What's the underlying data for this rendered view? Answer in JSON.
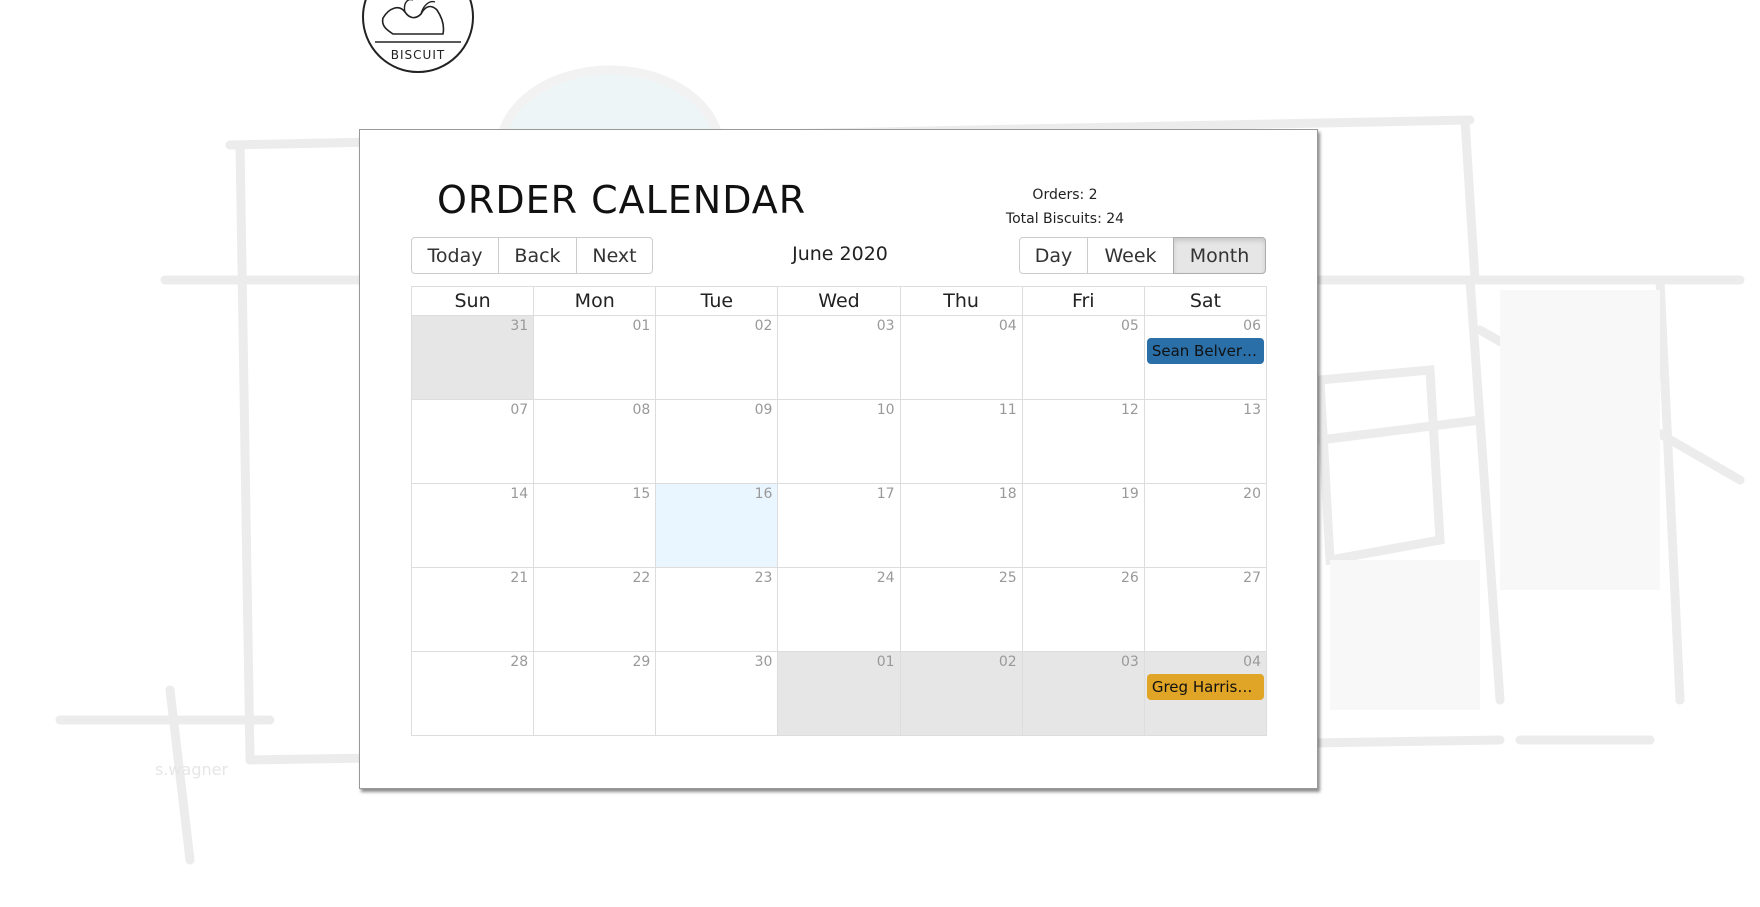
{
  "logo": {
    "text": "BISCUIT",
    "icon": "rooster-icon"
  },
  "calendar": {
    "title": "ORDER CALENDAR",
    "orders_label": "Orders: 2",
    "biscuits_label": "Total Biscuits: 24",
    "month_label": "June 2020",
    "nav": {
      "today": "Today",
      "back": "Back",
      "next": "Next"
    },
    "views": {
      "day": "Day",
      "week": "Week",
      "month": "Month",
      "active": "Month"
    },
    "weekdays": [
      "Sun",
      "Mon",
      "Tue",
      "Wed",
      "Thu",
      "Fri",
      "Sat"
    ],
    "weeks": [
      [
        "31",
        "01",
        "02",
        "03",
        "04",
        "05",
        "06"
      ],
      [
        "07",
        "08",
        "09",
        "10",
        "11",
        "12",
        "13"
      ],
      [
        "14",
        "15",
        "16",
        "17",
        "18",
        "19",
        "20"
      ],
      [
        "21",
        "22",
        "23",
        "24",
        "25",
        "26",
        "27"
      ],
      [
        "28",
        "29",
        "30",
        "01",
        "02",
        "03",
        "04"
      ]
    ],
    "events": [
      {
        "label": "Sean Belverst...",
        "color": "#2a6fa8"
      },
      {
        "label": "Greg Harrison ...",
        "color": "#e0a526"
      }
    ]
  },
  "colors": {
    "off_range": "#e6e6e6",
    "today": "#eaf6ff",
    "event_blue": "#2a6fa8",
    "event_gold": "#e0a526"
  }
}
